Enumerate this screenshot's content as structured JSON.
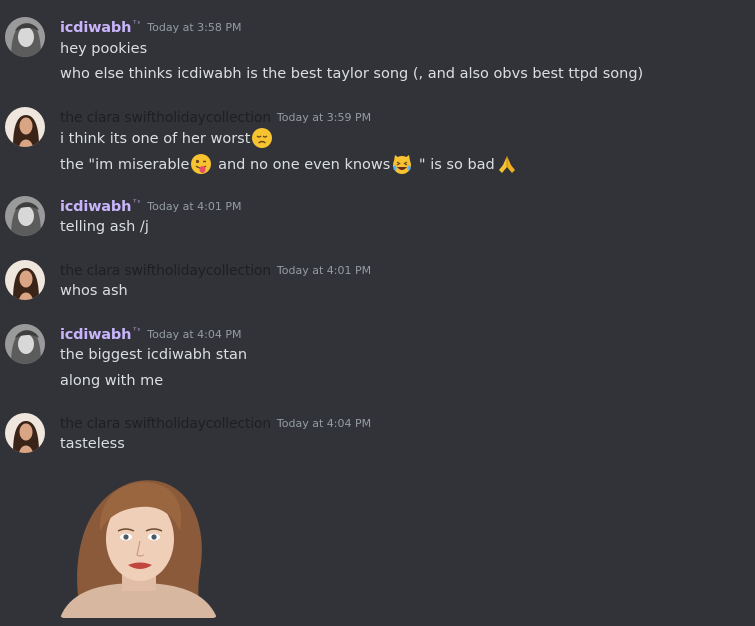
{
  "users": {
    "a": {
      "name": "icdiwabh",
      "tag": "ᵀˢ"
    },
    "b": {
      "name": "the clara swiftholidaycollection"
    }
  },
  "messages": [
    {
      "author": "icdiwabh",
      "timestamp": "Today at 3:58 PM",
      "lines": [
        "hey pookies",
        "who else thinks icdiwabh is the best taylor song (, and also obvs best ttpd song)"
      ]
    },
    {
      "author": "the clara swiftholidaycollection",
      "timestamp": "Today at 3:59 PM",
      "lines": [
        {
          "text": "i think its one of her worst",
          "emoji_after": "disappointed-face"
        },
        {
          "part1": "the \"im miserable",
          "emoji1": "winking-tongue-face",
          "part2": " and no one even knows",
          "emoji2": "laughing-cat-face",
          "part3": " \" is so bad",
          "emoji3": "folded-hands"
        }
      ]
    },
    {
      "author": "icdiwabh",
      "timestamp": "Today at 4:01 PM",
      "lines": [
        "telling ash /j"
      ]
    },
    {
      "author": "the clara swiftholidaycollection",
      "timestamp": "Today at 4:01 PM",
      "lines": [
        "whos ash"
      ]
    },
    {
      "author": "icdiwabh",
      "timestamp": "Today at 4:04 PM",
      "lines": [
        "the biggest icdiwabh stan",
        "along with me"
      ]
    },
    {
      "author": "the clara swiftholidaycollection",
      "timestamp": "Today at 4:04 PM",
      "lines": [
        "tasteless"
      ],
      "attachment": "portrait-image"
    }
  ],
  "colors": {
    "background": "#313338",
    "text": "#dbdee1",
    "timestamp": "#949ba4",
    "user_a": "#c9b4fb",
    "user_b": "#1e1f22"
  }
}
